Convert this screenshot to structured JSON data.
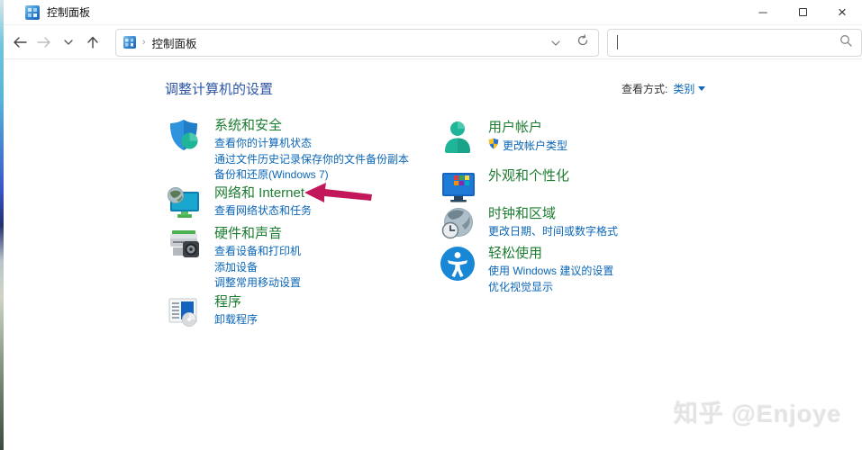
{
  "window": {
    "title": "控制面板",
    "minimize_glyph": "─",
    "close_glyph": "×"
  },
  "toolbar": {
    "address": {
      "crumb_separator": "›",
      "crumb": "控制面板"
    },
    "search": {
      "value": ""
    }
  },
  "content": {
    "heading": "调整计算机的设置",
    "view_by_label": "查看方式:",
    "view_by_value": "类别",
    "columns": {
      "left": [
        {
          "title": "系统和安全",
          "links": [
            "查看你的计算机状态",
            "通过文件历史记录保存你的文件备份副本",
            "备份和还原(Windows 7)"
          ]
        },
        {
          "title": "网络和 Internet",
          "links": [
            "查看网络状态和任务"
          ]
        },
        {
          "title": "硬件和声音",
          "links": [
            "查看设备和打印机",
            "添加设备",
            "调整常用移动设置"
          ]
        },
        {
          "title": "程序",
          "links": [
            "卸载程序"
          ]
        }
      ],
      "right": [
        {
          "title": "用户帐户",
          "links": [
            "更改帐户类型"
          ]
        },
        {
          "title": "外观和个性化",
          "links": []
        },
        {
          "title": "时钟和区域",
          "links": [
            "更改日期、时间或数字格式"
          ]
        },
        {
          "title": "轻松使用",
          "links": [
            "使用 Windows 建议的设置",
            "优化视觉显示"
          ]
        }
      ]
    }
  },
  "watermark": "知乎 @Enjoye",
  "colors": {
    "category_title": "#1e7d31",
    "link_blue": "#0a66b7",
    "heading_blue": "#2d55a5",
    "arrow_pink": "#c2185b"
  },
  "icons": [
    "control-panel-icon",
    "back-icon",
    "forward-icon",
    "recent-pages-icon",
    "up-icon",
    "refresh-icon",
    "search-icon",
    "shield-icon",
    "network-icon",
    "hardware-icon",
    "programs-icon",
    "user-icon",
    "uac-shield-icon",
    "appearance-icon",
    "clock-region-icon",
    "ease-of-access-icon"
  ]
}
